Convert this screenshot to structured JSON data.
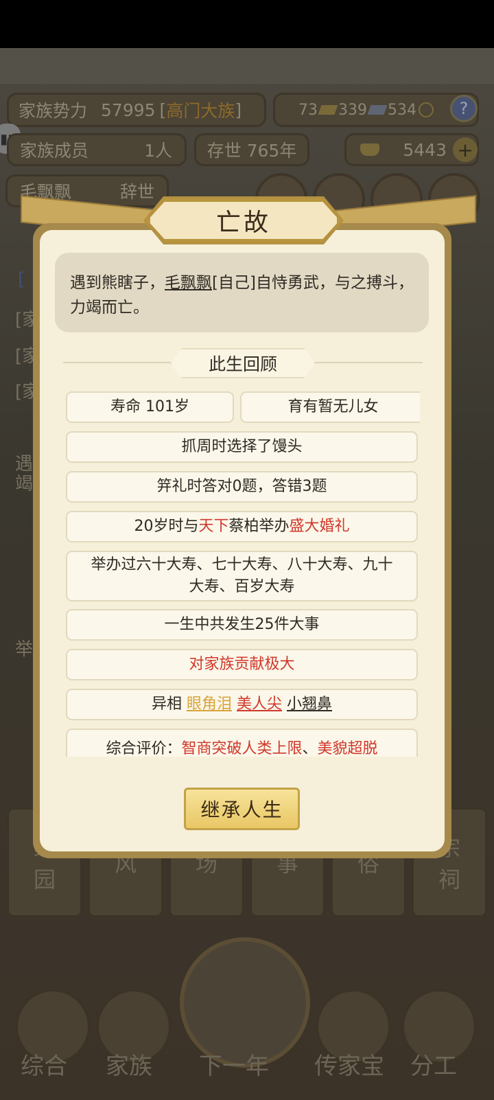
{
  "header": {
    "family_power_label": "家族势力",
    "family_power_value": "57995",
    "family_rank": "高门大族",
    "res1": "73",
    "res2": "339",
    "res3": "534",
    "help_symbol": "?",
    "members_label": "家族成员",
    "members_value": "1人",
    "existence": "存世 765年",
    "gold": "5443",
    "plus_symbol": "+",
    "person_name": "毛飘飘",
    "person_status": "辞世"
  },
  "background_log": [
    "遇",
    "竭",
    "[家",
    "[家",
    "[家",
    "举"
  ],
  "dialog": {
    "title": "亡故",
    "cause_prefix": "遇到熊瞎子，",
    "cause_name": "毛飘飘",
    "cause_suffix": "[自己]自恃勇武，与之搏斗，力竭而亡。",
    "section_title": "此生回顾",
    "lifespan": "寿命 101岁",
    "children": "育有暂无儿女",
    "zhuazhou": "抓周时选择了馒头",
    "jili": "笄礼时答对0题，答错3题",
    "marriage_pre": "20岁时与",
    "marriage_realm": "天下",
    "marriage_mid": "蔡柏举办",
    "marriage_type": "盛大婚礼",
    "birthdays": "举办过六十大寿、七十大寿、八十大寿、九十大寿、百岁大寿",
    "events": "一生中共发生25件大事",
    "contribution": "对家族贡献极大",
    "features_label": "异相",
    "feature1": "眼角泪",
    "feature2": "美人尖",
    "feature3": "小翘鼻",
    "eval_label": "综合评价：",
    "eval_value1": "智商突破人类上限",
    "eval_sep": "、",
    "eval_value2": "美貌超脱",
    "inherit_button": "继承人生"
  },
  "bottom_tiles": [
    {
      "top": "绿",
      "bottom": "园"
    },
    {
      "top": "",
      "bottom": "风"
    },
    {
      "top": "",
      "bottom": "场"
    },
    {
      "top": "",
      "bottom": "事"
    },
    {
      "top": "",
      "bottom": "俗"
    },
    {
      "top": "宗",
      "bottom": "祠"
    }
  ],
  "nav": [
    "综合",
    "家族",
    "下一年",
    "传家宝",
    "分工"
  ],
  "colors": {
    "accent_red": "#d0382b",
    "accent_gold": "#d9a33a",
    "dialog_bg": "#f6f0da"
  }
}
